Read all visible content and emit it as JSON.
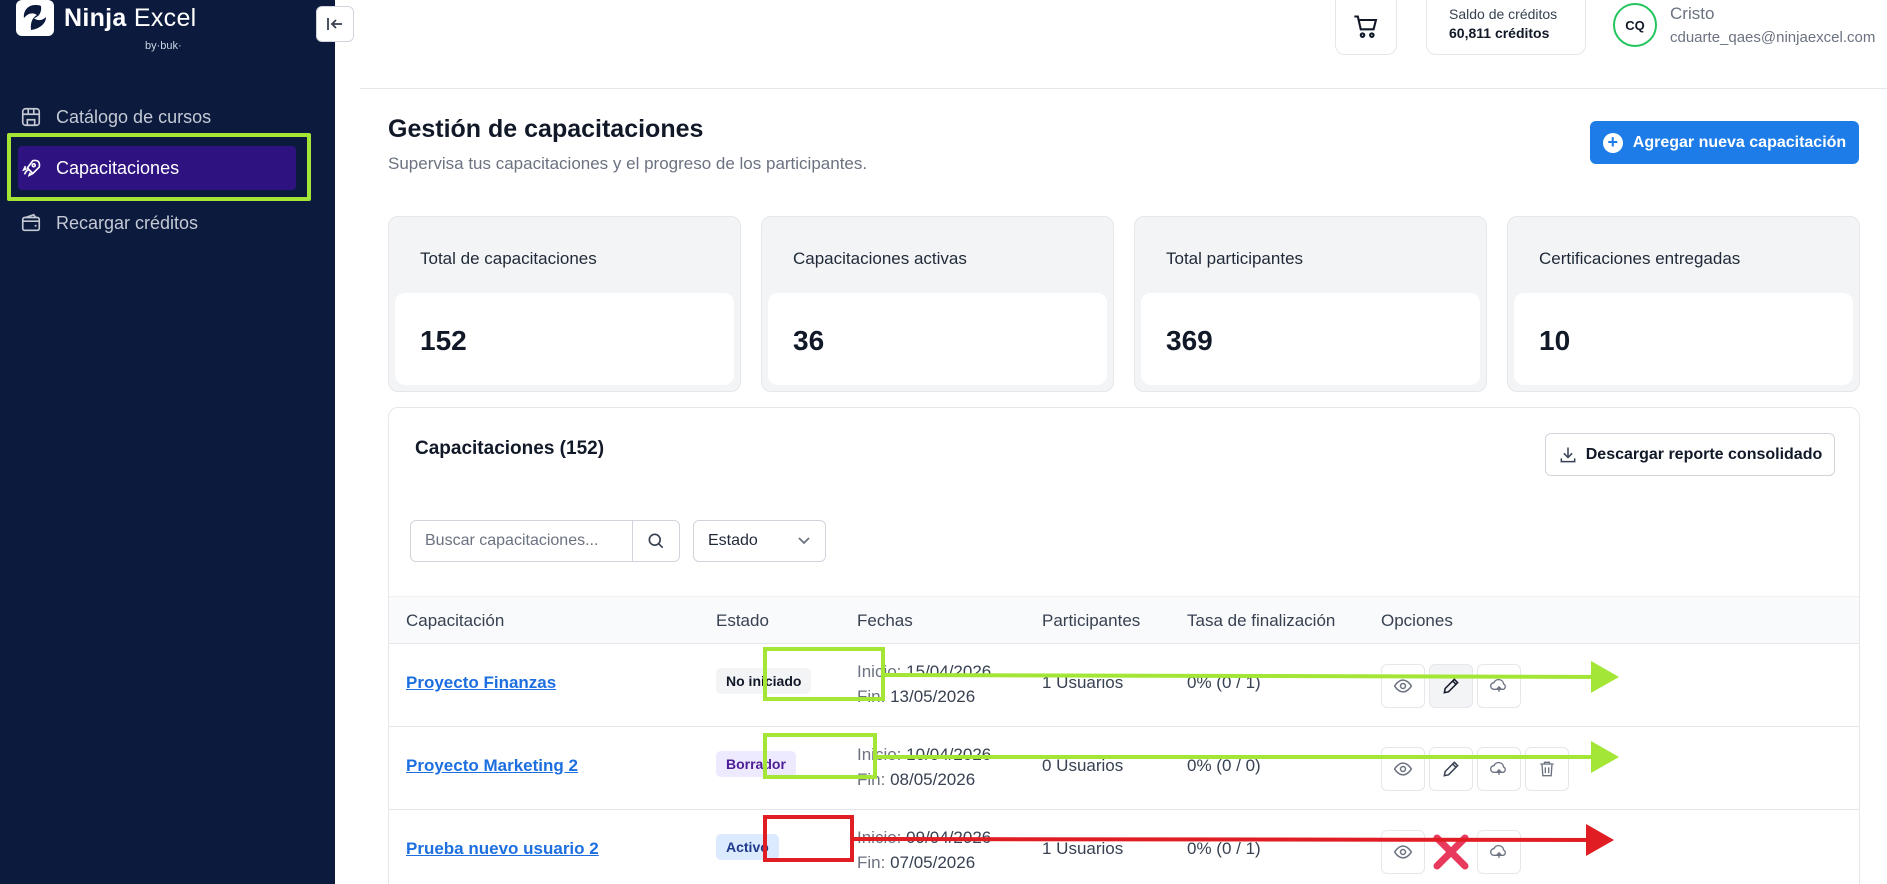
{
  "brand": {
    "name_bold": "Ninja",
    "name_light": "Excel",
    "byline": "by·buk·"
  },
  "sidebar": {
    "items": [
      {
        "label": "Catálogo de cursos",
        "icon": "store-icon"
      },
      {
        "label": "Capacitaciones",
        "icon": "rocket-icon",
        "active": true
      },
      {
        "label": "Recargar créditos",
        "icon": "wallet-icon"
      }
    ]
  },
  "topbar": {
    "credits_label": "Saldo de créditos",
    "credits_value": "60,811 créditos",
    "avatar_initials": "CQ",
    "user_name": "Cristo",
    "user_email": "cduarte_qaes@ninjaexcel.com"
  },
  "header": {
    "title": "Gestión de capacitaciones",
    "subtitle": "Supervisa tus capacitaciones y el progreso de los participantes.",
    "add_button": "Agregar nueva capacitación"
  },
  "stats": [
    {
      "label": "Total de capacitaciones",
      "value": "152"
    },
    {
      "label": "Capacitaciones activas",
      "value": "36"
    },
    {
      "label": "Total participantes",
      "value": "369"
    },
    {
      "label": "Certificaciones entregadas",
      "value": "10"
    }
  ],
  "table": {
    "title": "Capacitaciones (152)",
    "download_button": "Descargar reporte consolidado",
    "search_placeholder": "Buscar capacitaciones...",
    "estado_filter": "Estado",
    "columns": [
      "Capacitación",
      "Estado",
      "Fechas",
      "Participantes",
      "Tasa de finalización",
      "Opciones"
    ],
    "date_start_label": "Inicio:",
    "date_end_label": "Fin:",
    "rows": [
      {
        "name": "Proyecto Finanzas",
        "status": "No iniciado",
        "start": "15/04/2026",
        "end": "13/05/2026",
        "participants": "1 Usuarios",
        "rate": "0% (0 / 1)"
      },
      {
        "name": "Proyecto Marketing 2",
        "status": "Borrador",
        "start": "10/04/2026",
        "end": "08/05/2026",
        "participants": "0 Usuarios",
        "rate": "0% (0 / 0)"
      },
      {
        "name": "Prueba nuevo usuario 2",
        "status": "Activo",
        "start": "09/04/2026",
        "end": "07/05/2026",
        "participants": "1 Usuarios",
        "rate": "0% (0 / 1)"
      }
    ]
  },
  "colors": {
    "sidebar_bg": "#0b1a3d",
    "active_nav": "#2e1380",
    "primary": "#1d7ce8",
    "highlight_green": "#a3e635",
    "highlight_red": "#e11d24"
  }
}
